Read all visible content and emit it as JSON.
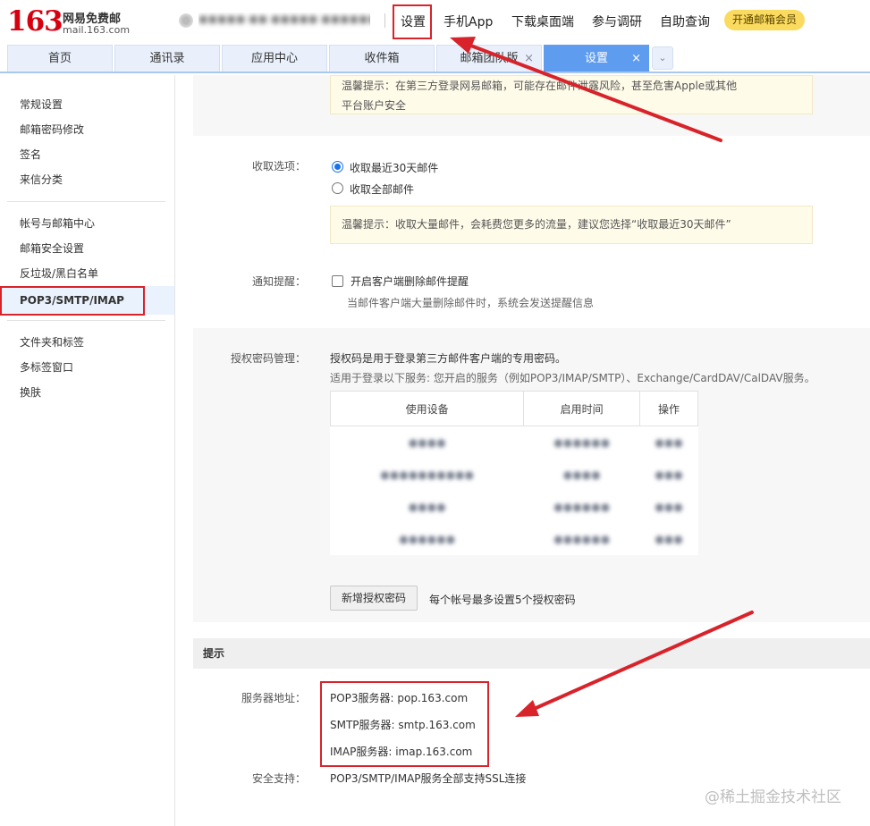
{
  "brand": {
    "number": "163",
    "name": "网易免费邮",
    "domain": "mail.163.com",
    "color": "#d7000f"
  },
  "account": {
    "name": "●●●●● ●● ●●●●● ●●●●●●●●"
  },
  "topnav": [
    "设置",
    "手机App",
    "下载桌面端",
    "参与调研",
    "自助查询"
  ],
  "vip_label": "开通邮箱会员",
  "tabs": [
    {
      "label": "首页",
      "closable": false,
      "active": false
    },
    {
      "label": "通讯录",
      "closable": false,
      "active": false
    },
    {
      "label": "应用中心",
      "closable": false,
      "active": false
    },
    {
      "label": "收件箱",
      "closable": false,
      "active": false
    },
    {
      "label": "邮箱团队版",
      "closable": true,
      "active": false
    },
    {
      "label": "设置",
      "closable": true,
      "active": true
    }
  ],
  "tab_close_glyph": "×",
  "tab_dropdown_glyph": "⌄",
  "sidebar": {
    "group1": [
      "常规设置",
      "邮箱密码修改",
      "签名",
      "来信分类"
    ],
    "group2": [
      "帐号与邮箱中心",
      "邮箱安全设置",
      "反垃圾/黑白名单",
      "POP3/SMTP/IMAP"
    ],
    "group3": [
      "文件夹和标签",
      "多标签窗口",
      "换肤"
    ],
    "active": "POP3/SMTP/IMAP"
  },
  "top_tip": {
    "line1": "温馨提示：在第三方登录网易邮箱，可能存在邮件泄露风险，甚至危害Apple或其他",
    "line2": "平台账户安全"
  },
  "fetch": {
    "label": "收取选项：",
    "options": [
      "收取最近30天邮件",
      "收取全部邮件"
    ],
    "selected": 0,
    "tip": "温馨提示：收取大量邮件，会耗费您更多的流量，建议您选择“收取最近30天邮件”"
  },
  "notify": {
    "label": "通知提醒：",
    "checkbox_label": "开启客户端删除邮件提醒",
    "checked": false,
    "desc": "当邮件客户端大量删除邮件时，系统会发送提醒信息"
  },
  "auth": {
    "label": "授权密码管理：",
    "line1": "授权码是用于登录第三方邮件客户端的专用密码。",
    "line2": "适用于登录以下服务: 您开启的服务（例如POP3/IMAP/SMTP）、Exchange/CardDAV/CalDAV服务。",
    "columns": [
      "使用设备",
      "启用时间",
      "操作"
    ],
    "rows": [
      [
        "●●●●",
        "●●●●●●",
        "●●●"
      ],
      [
        "●●●●●●●●●●",
        "●●●●",
        "●●●"
      ],
      [
        "●●●●",
        "●●●●●●",
        "●●●"
      ],
      [
        "●●●●●●",
        "●●●●●●",
        "●●●"
      ]
    ],
    "add_button": "新增授权密码",
    "add_note": "每个帐号最多设置5个授权密码"
  },
  "hint": {
    "title": "提示",
    "server_label": "服务器地址：",
    "servers": [
      "POP3服务器: pop.163.com",
      "SMTP服务器: smtp.163.com",
      "IMAP服务器: imap.163.com"
    ],
    "ssl_label": "安全支持：",
    "ssl_value": "POP3/SMTP/IMAP服务全部支持SSL连接"
  },
  "watermark": "@稀土掘金技术社区",
  "annotation_color": "#d8232a"
}
